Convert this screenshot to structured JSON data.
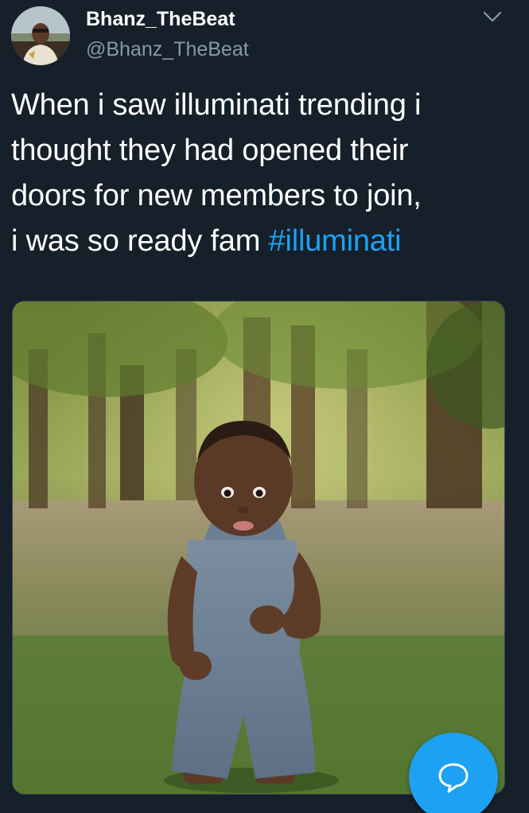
{
  "tweet": {
    "author": {
      "display_name": "Bhanz_TheBeat",
      "handle": "@Bhanz_TheBeat"
    },
    "text_lines": [
      "When i saw illuminati trending i",
      "thought they had opened their",
      "doors for new members to join,",
      "i was so ready fam "
    ],
    "hashtag": "#illuminati"
  },
  "icons": {
    "menu": "chevron-down-icon",
    "compose": "message-bubble-icon"
  },
  "colors": {
    "background": "#15202b",
    "text": "#ffffff",
    "secondary_text": "#8899a6",
    "accent": "#1da1f2",
    "border": "#38444d"
  }
}
